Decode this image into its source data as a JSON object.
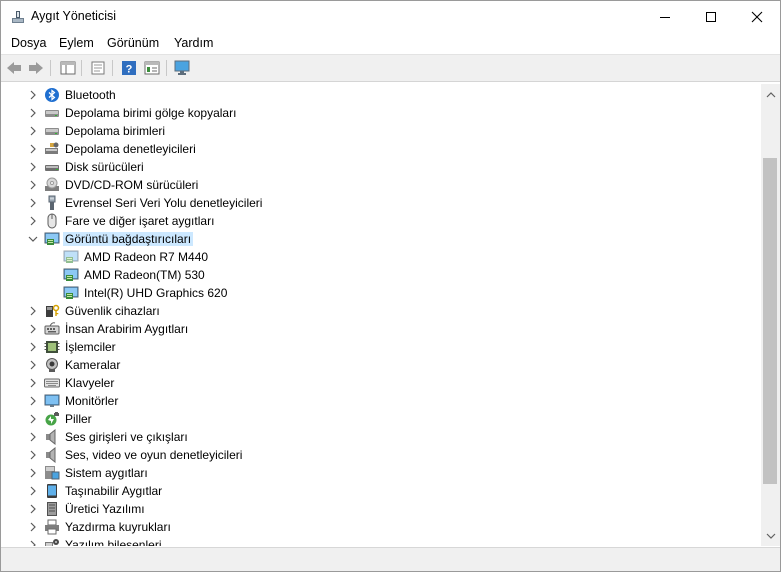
{
  "window": {
    "title": "Aygıt Yöneticisi"
  },
  "menu": [
    "Dosya",
    "Eylem",
    "Görünüm",
    "Yardım"
  ],
  "toolbar": [
    "back-icon",
    "forward-icon",
    "properties-icon",
    "update-driver-icon",
    "help-icon",
    "action-view-icon",
    "monitor-scan-icon"
  ],
  "tree": {
    "items": [
      {
        "label": "Bluetooth",
        "icon": "bluetooth-icon",
        "expander": "collapsed"
      },
      {
        "label": "Depolama birimi gölge kopyaları",
        "icon": "drive-icon",
        "expander": "collapsed"
      },
      {
        "label": "Depolama birimleri",
        "icon": "drive-icon",
        "expander": "collapsed"
      },
      {
        "label": "Depolama denetleyicileri",
        "icon": "storage-controller-icon",
        "expander": "collapsed"
      },
      {
        "label": "Disk sürücüleri",
        "icon": "disk-icon",
        "expander": "collapsed"
      },
      {
        "label": "DVD/CD-ROM sürücüleri",
        "icon": "dvd-icon",
        "expander": "collapsed"
      },
      {
        "label": "Evrensel Seri Veri Yolu denetleyicileri",
        "icon": "usb-icon",
        "expander": "collapsed"
      },
      {
        "label": "Fare ve diğer işaret aygıtları",
        "icon": "mouse-icon",
        "expander": "collapsed"
      },
      {
        "label": "Görüntü bağdaştırıcıları",
        "icon": "display-adapter-icon",
        "expander": "expanded",
        "selected": true
      },
      {
        "label": "AMD Radeon R7 M440",
        "icon": "display-adapter-icon",
        "child": true
      },
      {
        "label": "AMD Radeon(TM) 530",
        "icon": "display-adapter-icon",
        "child": true
      },
      {
        "label": "Intel(R) UHD Graphics 620",
        "icon": "display-adapter-icon",
        "child": true
      },
      {
        "label": "Güvenlik cihazları",
        "icon": "security-icon",
        "expander": "collapsed"
      },
      {
        "label": "İnsan Arabirim Aygıtları",
        "icon": "hid-icon",
        "expander": "collapsed"
      },
      {
        "label": "İşlemciler",
        "icon": "processor-icon",
        "expander": "collapsed"
      },
      {
        "label": "Kameralar",
        "icon": "camera-icon",
        "expander": "collapsed"
      },
      {
        "label": "Klavyeler",
        "icon": "keyboard-icon",
        "expander": "collapsed"
      },
      {
        "label": "Monitörler",
        "icon": "monitor-icon",
        "expander": "collapsed"
      },
      {
        "label": "Piller",
        "icon": "battery-icon",
        "expander": "collapsed"
      },
      {
        "label": "Ses girişleri ve çıkışları",
        "icon": "speaker-icon",
        "expander": "collapsed"
      },
      {
        "label": "Ses, video ve oyun denetleyicileri",
        "icon": "speaker-icon",
        "expander": "collapsed"
      },
      {
        "label": "Sistem aygıtları",
        "icon": "system-device-icon",
        "expander": "collapsed"
      },
      {
        "label": "Taşınabilir Aygıtlar",
        "icon": "portable-device-icon",
        "expander": "collapsed"
      },
      {
        "label": "Üretici Yazılımı",
        "icon": "firmware-icon",
        "expander": "collapsed"
      },
      {
        "label": "Yazdırma kuyrukları",
        "icon": "printer-icon",
        "expander": "collapsed"
      },
      {
        "label": "Yazılım bileşenleri",
        "icon": "software-component-icon",
        "expander": "collapsed"
      }
    ]
  },
  "scrollbar": {
    "thumb_start": 0.13,
    "thumb_fraction": 0.77
  },
  "colors": {
    "selection": "#cce8ff",
    "accent": "#0078d7",
    "toolbar_bg": "#f0f0f0"
  }
}
